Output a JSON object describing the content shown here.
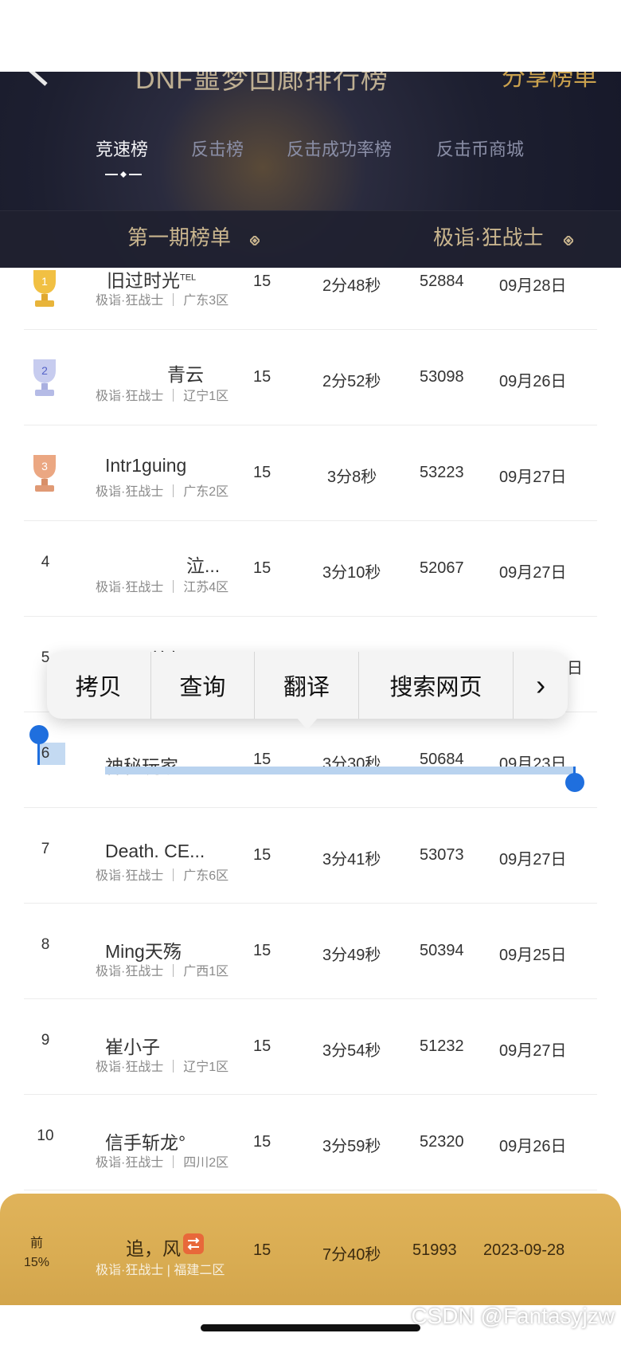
{
  "header": {
    "title": "DNF噩梦回廊排行榜",
    "share": "分享榜单",
    "tabs": [
      "竞速榜",
      "反击榜",
      "反击成功率榜",
      "反击币商城"
    ],
    "filter_period": "第一期榜单",
    "filter_class": "极诣·狂战士"
  },
  "rows": [
    {
      "rank": "1",
      "name": "旧过时光",
      "name_suffix": "TEL",
      "meta_class": "极诣·狂战士",
      "meta_server": "广东3区",
      "floors": "15",
      "time": "2分48秒",
      "score": "52884",
      "date": "09月28日",
      "medal": "gold"
    },
    {
      "rank": "2",
      "name": "青云",
      "meta_class": "极诣·狂战士",
      "meta_server": "辽宁1区",
      "floors": "15",
      "time": "2分52秒",
      "score": "53098",
      "date": "09月26日",
      "medal": "silver"
    },
    {
      "rank": "3",
      "name": "Intr1guing",
      "meta_class": "极诣·狂战士",
      "meta_server": "广东2区",
      "floors": "15",
      "time": "3分8秒",
      "score": "53223",
      "date": "09月27日",
      "medal": "bronze"
    },
    {
      "rank": "4",
      "name": "泣...",
      "meta_class": "极诣·狂战士",
      "meta_server": "江苏4区",
      "floors": "15",
      "time": "3分10秒",
      "score": "52067",
      "date": "09月27日"
    },
    {
      "rank": "5",
      "name": "N°着句",
      "meta_class": "",
      "meta_server": "",
      "floors": "",
      "time": "",
      "score": "",
      "date": "日"
    },
    {
      "rank": "6",
      "name": "神秘玩家",
      "meta_class": "",
      "meta_server": "",
      "floors": "15",
      "time": "3分30秒",
      "score": "50684",
      "date": "09月23日"
    },
    {
      "rank": "7",
      "name": "Death.  CE...",
      "meta_class": "极诣·狂战士",
      "meta_server": "广东6区",
      "floors": "15",
      "time": "3分41秒",
      "score": "53073",
      "date": "09月27日"
    },
    {
      "rank": "8",
      "name": "Ming天殇",
      "meta_class": "极诣·狂战士",
      "meta_server": "广西1区",
      "floors": "15",
      "time": "3分49秒",
      "score": "50394",
      "date": "09月25日"
    },
    {
      "rank": "9",
      "name": "崔小子",
      "meta_class": "极诣·狂战士",
      "meta_server": "辽宁1区",
      "floors": "15",
      "time": "3分54秒",
      "score": "51232",
      "date": "09月27日"
    },
    {
      "rank": "10",
      "name": "信手斩龙°",
      "meta_class": "极诣·狂战士",
      "meta_server": "四川2区",
      "floors": "15",
      "time": "3分59秒",
      "score": "52320",
      "date": "09月26日"
    }
  ],
  "context_menu": {
    "copy": "拷贝",
    "lookup": "查询",
    "translate": "翻译",
    "search_web": "搜索网页",
    "more": "›"
  },
  "my_rank": {
    "rank_top": "前",
    "rank_pct": "15%",
    "name": "追，风",
    "meta_class": "极诣·狂战士",
    "meta_server": "福建二区",
    "floors": "15",
    "time": "7分40秒",
    "score": "51993",
    "date": "2023-09-28"
  },
  "watermark": "CSDN @Fantasyjzw",
  "colors": {
    "header_bg": "#1d1f30",
    "gold": "#d9ac52",
    "selection": "#1f6fde"
  }
}
